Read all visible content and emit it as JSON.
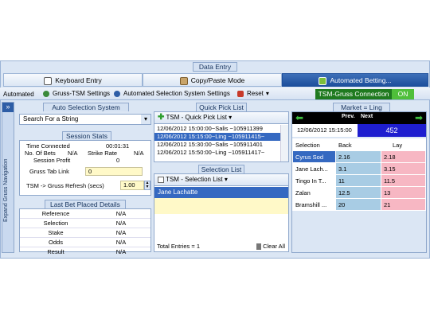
{
  "window_title": "Data Entry",
  "tabs": [
    {
      "label": "Keyboard Entry",
      "icon": "keyboard-icon"
    },
    {
      "label": "Copy/Paste Mode",
      "icon": "clipboard-icon"
    },
    {
      "label": "Automated Betting...",
      "icon": "robot-icon"
    }
  ],
  "toolbar": {
    "mode_label": "Automated",
    "gruss_settings": "Gruss-TSM Settings",
    "auto_settings": "Automated Selection System Settings",
    "reset": "Reset",
    "connection_label": "TSM-Gruss Connection",
    "connection_state": "ON"
  },
  "side_nav": {
    "label": "Expand Gruss Navigation",
    "expand": "»"
  },
  "auto_selection": {
    "title": "Auto Selection System",
    "search_value": "Search For a String"
  },
  "session_stats": {
    "title": "Session Stats",
    "time_connected_label": "Time Connected",
    "time_connected": "00:01:31",
    "num_bets_label": "No. Of Bets",
    "num_bets": "N/A",
    "strike_rate_label": "Strike Rate",
    "strike_rate": "N/A",
    "profit_label": "Session Profit",
    "profit": "0",
    "tab_link_label": "Gruss Tab Link",
    "tab_link_value": "0",
    "refresh_label": "TSM -> Gruss Refresh (secs)",
    "refresh_value": "1.00"
  },
  "last_bet": {
    "title": "Last Bet Placed Details",
    "rows": [
      {
        "label": "Reference",
        "value": "N/A"
      },
      {
        "label": "Selection",
        "value": "N/A"
      },
      {
        "label": "Stake",
        "value": "N/A"
      },
      {
        "label": "Odds",
        "value": "N/A"
      },
      {
        "label": "Result",
        "value": "N/A"
      }
    ]
  },
  "quick_pick": {
    "title": "Quick Pick List",
    "toolbar": "TSM - Quick Pick List",
    "items": [
      "12/06/2012 15:00:00~Salis ~105911399",
      "12/06/2012 15:15:00~Ling ~105911415~",
      "12/06/2012 15:30:00~Salis ~105911401",
      "12/06/2012 15:50:00~Ling ~105911417~"
    ]
  },
  "selection_list": {
    "title": "Selection List",
    "toolbar": "TSM - Selection List",
    "items": [
      "Jane Lachatte"
    ],
    "total_label": "Total Entries =",
    "total": "1",
    "clear_all": "Clear All"
  },
  "market": {
    "title": "Market = Ling",
    "prev": "Prev.",
    "next": "Next",
    "datetime": "12/06/2012 15:15:00",
    "market_id": "452",
    "headers": [
      "Selection",
      "Back",
      "Lay"
    ],
    "rows": [
      {
        "name": "Cyrus Sod",
        "back": "2.16",
        "lay": "2.18"
      },
      {
        "name": "Jane Lach...",
        "back": "3.1",
        "lay": "3.15"
      },
      {
        "name": "Tingo In T...",
        "back": "11",
        "lay": "11.5"
      },
      {
        "name": "Zalan",
        "back": "12.5",
        "lay": "13"
      },
      {
        "name": "Bramshill ...",
        "back": "20",
        "lay": "21"
      }
    ]
  }
}
